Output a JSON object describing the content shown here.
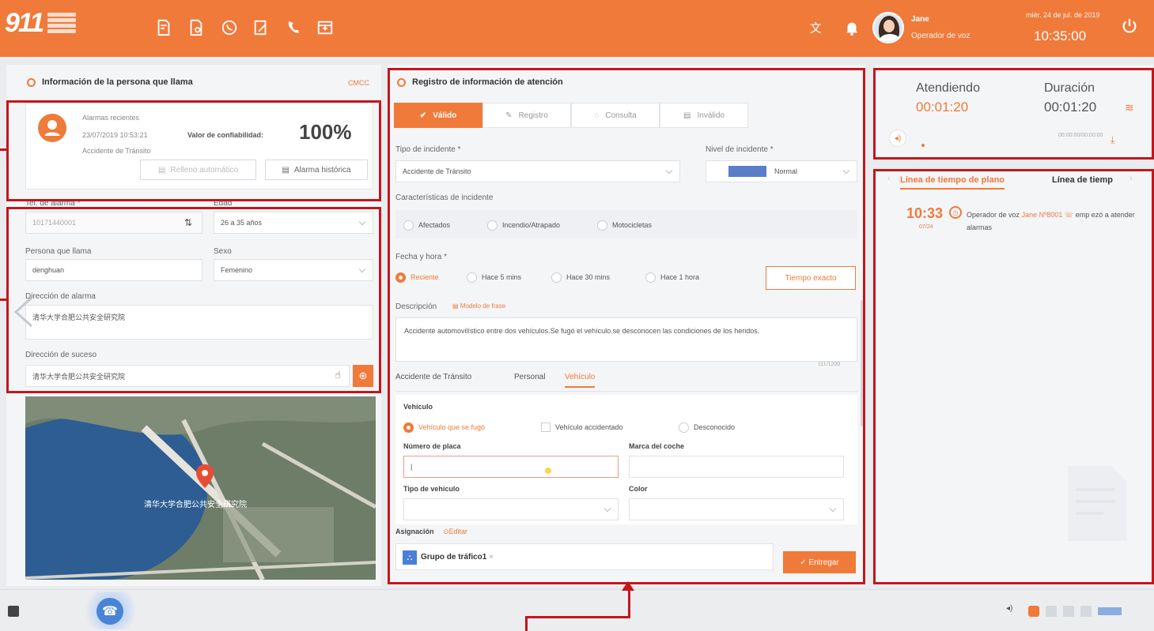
{
  "header": {
    "logo": "911",
    "user_name": "Jane",
    "user_role": "Operador de voz",
    "date": "miér. 24 de jul. de 2019",
    "time": "10:35:00",
    "icons": [
      "doc-icon",
      "doc2-icon",
      "whatsapp-icon",
      "edit-icon",
      "phone-icon",
      "calendar-icon",
      "translate-icon",
      "bell-icon",
      "power-icon"
    ]
  },
  "caller": {
    "title": "Información de la persona que llama",
    "carrier": "CMCC",
    "recent_alarms_label": "Alarmas recientes",
    "recent_date": "23/07/2019 10:53:21",
    "recent_type": "Accidente de Tránsito",
    "reliability_label": "Valor de confiabilidad:",
    "reliability_value": "100%",
    "auto_redial_label": "Relleno automático",
    "history_label": "Alarma histórica",
    "phone_label": "Tel. de alarma *",
    "phone_value": "10171440001",
    "age_label": "Edad",
    "age_value": "26 a 35 años",
    "caller_label": "Persona que llama",
    "caller_value": "denghuan",
    "sex_label": "Sexo",
    "sex_value": "Femenino",
    "alarm_address_label": "Dirección de alarma",
    "alarm_address_value": "清华大学合肥公共安全研究院",
    "event_address_label": "Dirección de suceso",
    "event_address_value": "清华大学合肥公共安全研究院",
    "map_label": "清华大学合肥公共安全研究院"
  },
  "attention": {
    "title": "Registro de información de atención",
    "tabs": [
      "Válido",
      "Registro",
      "Consulta",
      "Inválido"
    ],
    "incident_type_label": "Tipo de incidente *",
    "incident_type_value": "Accidente de Tránsito",
    "incident_level_label": "Nivel de incidente *",
    "incident_level_value": "Normal",
    "level_color": "#5b7ec9",
    "features_label": "Características de incidente",
    "features": [
      "Afectados",
      "Incendio/Atrapado",
      "Motocicletas"
    ],
    "datetime_label": "Fecha y hora *",
    "time_options": [
      "Reciente",
      "Hace 5 mins",
      "Hace 30 mins",
      "Hace 1 hora"
    ],
    "exact_time_label": "Tiempo exacto",
    "description_label": "Descripción",
    "template_label": "Modelo de frase",
    "description_text": "Accidente automovilístico entre dos vehículos.Se fugó el vehículo.se desconocen las condiciones de los heridos.",
    "char_count": "111/1200",
    "subtabs": [
      "Accidente de Tránsito",
      "Personal",
      "Vehículo"
    ],
    "vehicle_title": "Vehículo",
    "vehicle_options": [
      "Vehículo que se fugó",
      "Vehículo accidentado",
      "Desconocido"
    ],
    "plate_label": "Número de placa",
    "plate_value": "|",
    "brand_label": "Marca del coche",
    "vtype_label": "Tipo de vehículo",
    "color_label": "Color",
    "assign_label": "Asignación",
    "edit_label": "Editar",
    "group_label": "Grupo de tráfico1",
    "submit_label": "Entregar"
  },
  "status": {
    "attending_label": "Atendiendo",
    "attending_value": "00:01:20",
    "duration_label": "Duración",
    "duration_value": "00:01:20",
    "progress_text": "00:00:00/00:00:00"
  },
  "timeline": {
    "tabs": [
      "Línea de tiempo de plano",
      "Línea de tiemp"
    ],
    "entry_time": "10:33",
    "entry_date": "07/24",
    "entry_text_pre": "Operador de voz",
    "entry_highlight": "Jane Nº8001",
    "entry_text_post": "emp ezó a atender alarmas"
  },
  "colors": {
    "accent": "#f07a3a",
    "annotation": "#c4161c"
  }
}
